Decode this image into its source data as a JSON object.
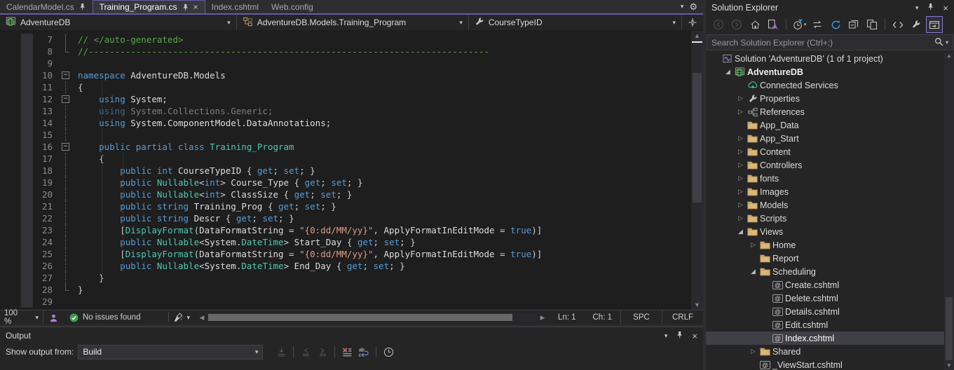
{
  "colors": {
    "accent": "#625BA6",
    "editor_bg": "#1E1E1E",
    "panel_bg": "#252526",
    "keyword": "#569CD6",
    "type": "#4EC9B0",
    "comment": "#57A64A",
    "string": "#D69D85",
    "folder": "#DCB67A",
    "selection": "#3F3F46"
  },
  "tab_bar": {
    "tabs": [
      {
        "label": "CalendarModel.cs",
        "active": false,
        "pinned": true,
        "close": false
      },
      {
        "label": "Training_Program.cs",
        "active": true,
        "pinned": true,
        "close": true
      },
      {
        "label": "Index.cshtml",
        "active": false,
        "pinned": false,
        "close": false
      },
      {
        "label": "Web.config",
        "active": false,
        "pinned": false,
        "close": false
      }
    ],
    "controls": [
      {
        "icon": "chevron-down-icon",
        "glyph": "▾"
      },
      {
        "icon": "gear-icon",
        "glyph": "⚙"
      }
    ]
  },
  "navbar": {
    "project": "AdventureDB",
    "type": "AdventureDB.Models.Training_Program",
    "member": "CourseTypeID"
  },
  "editor": {
    "lines": [
      {
        "n": "7",
        "fold": "bar",
        "tokens": [
          [
            "cm",
            "// </auto-generated>"
          ]
        ]
      },
      {
        "n": "8",
        "fold": "corner",
        "tokens": [
          [
            "cm",
            "//----------------------------------------------------------------------------"
          ]
        ]
      },
      {
        "n": "9",
        "fold": "",
        "tokens": []
      },
      {
        "n": "10",
        "fold": "box",
        "tokens": [
          [
            "kw",
            "namespace"
          ],
          [
            "pl",
            " "
          ],
          [
            "id",
            "AdventureDB.Models"
          ]
        ]
      },
      {
        "n": "11",
        "fold": "dash",
        "tokens": [
          [
            "pl",
            "{"
          ]
        ]
      },
      {
        "n": "12",
        "fold": "box",
        "tokens": [
          [
            "pl",
            "    "
          ],
          [
            "kw",
            "using"
          ],
          [
            "pl",
            " "
          ],
          [
            "id",
            "System;"
          ]
        ]
      },
      {
        "n": "13",
        "fold": "dash",
        "tokens": [
          [
            "kwdim",
            "    using"
          ],
          [
            "dim",
            " System.Collections.Generic;"
          ]
        ]
      },
      {
        "n": "14",
        "fold": "dash",
        "tokens": [
          [
            "pl",
            "    "
          ],
          [
            "kw",
            "using"
          ],
          [
            "pl",
            " "
          ],
          [
            "id",
            "System.ComponentModel.DataAnnotations;"
          ]
        ]
      },
      {
        "n": "15",
        "fold": "dash",
        "tokens": []
      },
      {
        "n": "16",
        "fold": "box",
        "tokens": [
          [
            "pl",
            "    "
          ],
          [
            "kw",
            "public partial class"
          ],
          [
            "pl",
            " "
          ],
          [
            "ty",
            "Training_Program"
          ]
        ]
      },
      {
        "n": "17",
        "fold": "dash",
        "tokens": [
          [
            "pl",
            "    {"
          ]
        ]
      },
      {
        "n": "18",
        "fold": "dash",
        "tokens": [
          [
            "pl",
            "        "
          ],
          [
            "kw",
            "public int"
          ],
          [
            "pl",
            " "
          ],
          [
            "id",
            "CourseTypeID"
          ],
          [
            "pl",
            " { "
          ],
          [
            "kw",
            "get"
          ],
          [
            "pl",
            "; "
          ],
          [
            "kw",
            "set"
          ],
          [
            "pl",
            "; }"
          ]
        ]
      },
      {
        "n": "19",
        "fold": "dash",
        "tokens": [
          [
            "pl",
            "        "
          ],
          [
            "kw",
            "public"
          ],
          [
            "pl",
            " "
          ],
          [
            "ty",
            "Nullable"
          ],
          [
            "pl",
            "<"
          ],
          [
            "kw",
            "int"
          ],
          [
            "pl",
            "> "
          ],
          [
            "id",
            "Course_Type"
          ],
          [
            "pl",
            " { "
          ],
          [
            "kw",
            "get"
          ],
          [
            "pl",
            "; "
          ],
          [
            "kw",
            "set"
          ],
          [
            "pl",
            "; }"
          ]
        ]
      },
      {
        "n": "20",
        "fold": "dash",
        "tokens": [
          [
            "pl",
            "        "
          ],
          [
            "kw",
            "public"
          ],
          [
            "pl",
            " "
          ],
          [
            "ty",
            "Nullable"
          ],
          [
            "pl",
            "<"
          ],
          [
            "kw",
            "int"
          ],
          [
            "pl",
            "> "
          ],
          [
            "id",
            "ClassSize"
          ],
          [
            "pl",
            " { "
          ],
          [
            "kw",
            "get"
          ],
          [
            "pl",
            "; "
          ],
          [
            "kw",
            "set"
          ],
          [
            "pl",
            "; }"
          ]
        ]
      },
      {
        "n": "21",
        "fold": "dash",
        "tokens": [
          [
            "pl",
            "        "
          ],
          [
            "kw",
            "public string"
          ],
          [
            "pl",
            " "
          ],
          [
            "id",
            "Training_Prog"
          ],
          [
            "pl",
            " { "
          ],
          [
            "kw",
            "get"
          ],
          [
            "pl",
            "; "
          ],
          [
            "kw",
            "set"
          ],
          [
            "pl",
            "; }"
          ]
        ]
      },
      {
        "n": "22",
        "fold": "dash",
        "tokens": [
          [
            "pl",
            "        "
          ],
          [
            "kw",
            "public string"
          ],
          [
            "pl",
            " "
          ],
          [
            "id",
            "Descr"
          ],
          [
            "pl",
            " { "
          ],
          [
            "kw",
            "get"
          ],
          [
            "pl",
            "; "
          ],
          [
            "kw",
            "set"
          ],
          [
            "pl",
            "; }"
          ]
        ]
      },
      {
        "n": "23",
        "fold": "dash",
        "tokens": [
          [
            "pl",
            "        ["
          ],
          [
            "ty",
            "DisplayFormat"
          ],
          [
            "pl",
            "("
          ],
          [
            "id",
            "DataFormatString"
          ],
          [
            "pl",
            " = "
          ],
          [
            "str",
            "\"{0:dd/MM/yy}\""
          ],
          [
            "pl",
            ", "
          ],
          [
            "id",
            "ApplyFormatInEditMode"
          ],
          [
            "pl",
            " = "
          ],
          [
            "kw",
            "true"
          ],
          [
            "pl",
            ")]"
          ]
        ]
      },
      {
        "n": "24",
        "fold": "dash",
        "tokens": [
          [
            "pl",
            "        "
          ],
          [
            "kw",
            "public"
          ],
          [
            "pl",
            " "
          ],
          [
            "ty",
            "Nullable"
          ],
          [
            "pl",
            "<"
          ],
          [
            "id",
            "System"
          ],
          [
            "pl",
            "."
          ],
          [
            "ty",
            "DateTime"
          ],
          [
            "pl",
            "> "
          ],
          [
            "id",
            "Start_Day"
          ],
          [
            "pl",
            " { "
          ],
          [
            "kw",
            "get"
          ],
          [
            "pl",
            "; "
          ],
          [
            "kw",
            "set"
          ],
          [
            "pl",
            "; }"
          ]
        ]
      },
      {
        "n": "25",
        "fold": "dash",
        "tokens": [
          [
            "pl",
            "        ["
          ],
          [
            "ty",
            "DisplayFormat"
          ],
          [
            "pl",
            "("
          ],
          [
            "id",
            "DataFormatString"
          ],
          [
            "pl",
            " = "
          ],
          [
            "str",
            "\"{0:dd/MM/yy}\""
          ],
          [
            "pl",
            ", "
          ],
          [
            "id",
            "ApplyFormatInEditMode"
          ],
          [
            "pl",
            " = "
          ],
          [
            "kw",
            "true"
          ],
          [
            "pl",
            ")]"
          ]
        ]
      },
      {
        "n": "26",
        "fold": "dash",
        "tokens": [
          [
            "pl",
            "        "
          ],
          [
            "kw",
            "public"
          ],
          [
            "pl",
            " "
          ],
          [
            "ty",
            "Nullable"
          ],
          [
            "pl",
            "<"
          ],
          [
            "id",
            "System"
          ],
          [
            "pl",
            "."
          ],
          [
            "ty",
            "DateTime"
          ],
          [
            "pl",
            "> "
          ],
          [
            "id",
            "End_Day"
          ],
          [
            "pl",
            " { "
          ],
          [
            "kw",
            "get"
          ],
          [
            "pl",
            "; "
          ],
          [
            "kw",
            "set"
          ],
          [
            "pl",
            "; }"
          ]
        ]
      },
      {
        "n": "27",
        "fold": "dash",
        "tokens": [
          [
            "pl",
            "    }"
          ]
        ]
      },
      {
        "n": "28",
        "fold": "corner",
        "tokens": [
          [
            "pl",
            "}"
          ]
        ]
      },
      {
        "n": "29",
        "fold": "",
        "tokens": []
      }
    ]
  },
  "status_bar": {
    "zoom": "100 %",
    "issues": "No issues found",
    "ln": "Ln: 1",
    "ch": "Ch: 1",
    "spc": "SPC",
    "eol": "CRLF"
  },
  "output": {
    "title": "Output",
    "show_from_label": "Show output from:",
    "selected_source": "Build",
    "toolbar": [
      {
        "icon": "goto-message-icon",
        "enabled": false
      },
      {
        "icon": "sep"
      },
      {
        "icon": "prev-message-icon",
        "enabled": false
      },
      {
        "icon": "next-message-icon",
        "enabled": false
      },
      {
        "icon": "sep"
      },
      {
        "icon": "clear-all-icon",
        "enabled": true
      },
      {
        "icon": "word-wrap-icon",
        "enabled": true
      },
      {
        "icon": "sep"
      },
      {
        "icon": "timestamp-icon",
        "enabled": true
      }
    ]
  },
  "solution_explorer": {
    "title": "Solution Explorer",
    "search_placeholder": "Search Solution Explorer (Ctrl+;)",
    "toolbar": [
      {
        "icon": "back-icon",
        "enabled": false
      },
      {
        "icon": "forward-icon",
        "enabled": false
      },
      {
        "icon": "home-icon",
        "enabled": true
      },
      {
        "icon": "switch-views-icon",
        "enabled": true
      },
      {
        "icon": "sep"
      },
      {
        "icon": "pending-changes-filter-icon",
        "enabled": true,
        "dropdown": true
      },
      {
        "icon": "sync-active-document-icon",
        "enabled": true
      },
      {
        "icon": "refresh-icon",
        "enabled": true
      },
      {
        "icon": "collapse-all-icon",
        "enabled": true
      },
      {
        "icon": "show-all-files-icon",
        "enabled": true
      },
      {
        "icon": "sep"
      },
      {
        "icon": "view-code-icon",
        "enabled": true
      },
      {
        "icon": "properties-icon",
        "enabled": true
      },
      {
        "icon": "preview-selected-items-icon",
        "enabled": true,
        "active": true
      }
    ],
    "tree": [
      {
        "label": "Solution 'AdventureDB' (1 of 1 project)",
        "depth": 0,
        "icon": "solution-icon",
        "arrow": "none"
      },
      {
        "label": "AdventureDB",
        "depth": 1,
        "icon": "web-project-icon",
        "arrow": "expanded",
        "bold": true
      },
      {
        "label": "Connected Services",
        "depth": 2,
        "icon": "connected-services-icon",
        "arrow": "none"
      },
      {
        "label": "Properties",
        "depth": 2,
        "icon": "properties-node-icon",
        "arrow": "collapsed"
      },
      {
        "label": "References",
        "depth": 2,
        "icon": "references-icon",
        "arrow": "collapsed"
      },
      {
        "label": "App_Data",
        "depth": 2,
        "icon": "folder-icon",
        "arrow": "none"
      },
      {
        "label": "App_Start",
        "depth": 2,
        "icon": "folder-icon",
        "arrow": "collapsed"
      },
      {
        "label": "Content",
        "depth": 2,
        "icon": "folder-icon",
        "arrow": "collapsed"
      },
      {
        "label": "Controllers",
        "depth": 2,
        "icon": "folder-icon",
        "arrow": "collapsed"
      },
      {
        "label": "fonts",
        "depth": 2,
        "icon": "folder-icon",
        "arrow": "collapsed"
      },
      {
        "label": "Images",
        "depth": 2,
        "icon": "folder-icon",
        "arrow": "collapsed"
      },
      {
        "label": "Models",
        "depth": 2,
        "icon": "folder-icon",
        "arrow": "collapsed"
      },
      {
        "label": "Scripts",
        "depth": 2,
        "icon": "folder-icon",
        "arrow": "collapsed"
      },
      {
        "label": "Views",
        "depth": 2,
        "icon": "folder-icon",
        "arrow": "expanded"
      },
      {
        "label": "Home",
        "depth": 3,
        "icon": "folder-icon",
        "arrow": "collapsed"
      },
      {
        "label": "Report",
        "depth": 3,
        "icon": "folder-icon",
        "arrow": "none"
      },
      {
        "label": "Scheduling",
        "depth": 3,
        "icon": "folder-icon",
        "arrow": "expanded"
      },
      {
        "label": "Create.cshtml",
        "depth": 4,
        "icon": "razor-view-icon",
        "arrow": "none"
      },
      {
        "label": "Delete.cshtml",
        "depth": 4,
        "icon": "razor-view-icon",
        "arrow": "none"
      },
      {
        "label": "Details.cshtml",
        "depth": 4,
        "icon": "razor-view-icon",
        "arrow": "none"
      },
      {
        "label": "Edit.cshtml",
        "depth": 4,
        "icon": "razor-view-icon",
        "arrow": "none"
      },
      {
        "label": "Index.cshtml",
        "depth": 4,
        "icon": "razor-view-icon",
        "arrow": "none",
        "selected": true
      },
      {
        "label": "Shared",
        "depth": 3,
        "icon": "folder-icon",
        "arrow": "collapsed"
      },
      {
        "label": "_ViewStart.cshtml",
        "depth": 3,
        "icon": "razor-view-icon",
        "arrow": "none"
      }
    ]
  }
}
